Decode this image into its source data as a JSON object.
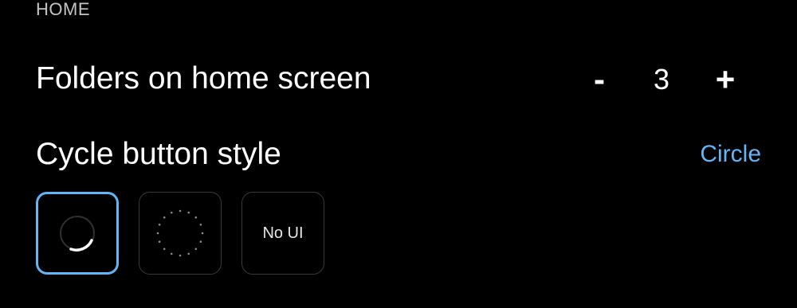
{
  "section": {
    "header": "HOME"
  },
  "folders_row": {
    "label": "Folders on home screen",
    "minus_label": "-",
    "value": "3",
    "plus_label": "+"
  },
  "cycle_row": {
    "label": "Cycle button style",
    "selected_value": "Circle",
    "options": [
      {
        "name": "circle",
        "label": "",
        "icon": "circle-arc-icon",
        "selected": true
      },
      {
        "name": "dotted",
        "label": "",
        "icon": "dotted-circle-icon",
        "selected": false
      },
      {
        "name": "no-ui",
        "label": "No UI",
        "icon": "",
        "selected": false
      }
    ]
  },
  "colors": {
    "background": "#000000",
    "accent": "#64b5f6",
    "text": "#ffffff",
    "header_text": "#c4c4c4",
    "option_border": "#3a3a3a"
  }
}
